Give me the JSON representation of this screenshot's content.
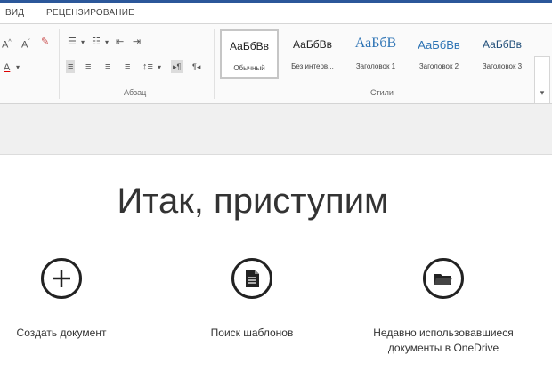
{
  "tabs": [
    {
      "label": "ВИД"
    },
    {
      "label": "РЕЦЕНЗИРОВАНИЕ"
    }
  ],
  "ribbon": {
    "paragraph_group_label": "Абзац",
    "styles_group_label": "Стили",
    "styles": [
      {
        "sample": "АаБбВв",
        "name": "Обычный",
        "active": true
      },
      {
        "sample": "АаБбВв",
        "name": "Без интерв...",
        "active": false
      },
      {
        "sample": "АаБбВ",
        "name": "Заголовок 1",
        "active": false
      },
      {
        "sample": "АаБбВв",
        "name": "Заголовок 2",
        "active": false
      },
      {
        "sample": "АаБбВв",
        "name": "Заголовок 3",
        "active": false
      }
    ]
  },
  "main": {
    "heading": "Итак, приступим",
    "actions": [
      {
        "label": "Создать документ",
        "icon": "plus-circle-icon"
      },
      {
        "label": "Поиск шаблонов",
        "icon": "document-icon"
      },
      {
        "label": "Недавно использовавшиеся документы в OneDrive",
        "icon": "folder-icon"
      }
    ]
  },
  "colors": {
    "accent": "#2b579a",
    "heading_style": "#2e74b5"
  }
}
